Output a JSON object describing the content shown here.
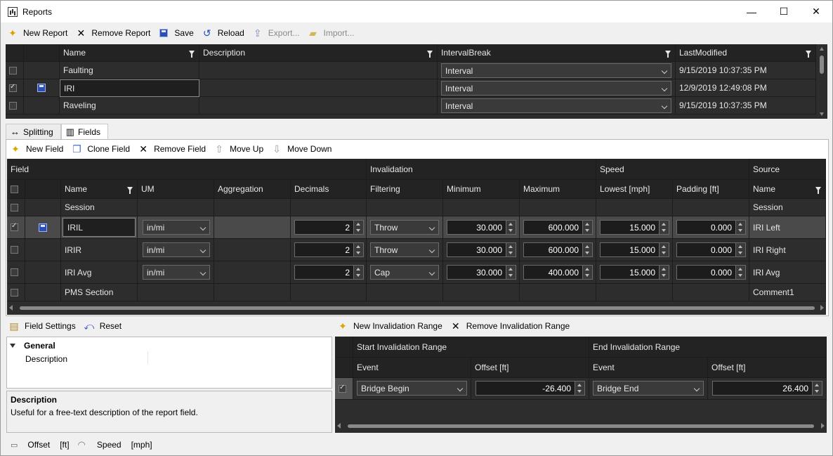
{
  "window": {
    "title": "Reports",
    "minimize": "—",
    "maximize": "☐",
    "close": "✕"
  },
  "reports_toolbar": {
    "new_report": "New Report",
    "remove_report": "Remove Report",
    "save": "Save",
    "reload": "Reload",
    "export": "Export...",
    "import": "Import..."
  },
  "reports_grid": {
    "columns": [
      "Name",
      "Description",
      "IntervalBreak",
      "LastModified"
    ],
    "rows": [
      {
        "checked": false,
        "saved": false,
        "name": "Faulting",
        "description": "",
        "interval_break": "Interval",
        "last_modified": "9/15/2019 10:37:35 PM"
      },
      {
        "checked": true,
        "saved": true,
        "name": "IRI",
        "description": "",
        "interval_break": "Interval",
        "last_modified": "12/9/2019 12:49:08 PM"
      },
      {
        "checked": false,
        "saved": false,
        "name": "Raveling",
        "description": "",
        "interval_break": "Interval",
        "last_modified": "9/15/2019 10:37:35 PM"
      }
    ]
  },
  "tabs": [
    {
      "label": "Splitting"
    },
    {
      "label": "Fields",
      "active": true
    }
  ],
  "fields_toolbar": {
    "new_field": "New Field",
    "clone_field": "Clone Field",
    "remove_field": "Remove Field",
    "move_up": "Move Up",
    "move_down": "Move Down"
  },
  "fields_grid": {
    "groups": {
      "field": "Field",
      "invalidation": "Invalidation",
      "speed": "Speed",
      "source": "Source"
    },
    "columns": {
      "name": "Name",
      "um": "UM",
      "aggregation": "Aggregation",
      "decimals": "Decimals",
      "filtering": "Filtering",
      "minimum": "Minimum",
      "maximum": "Maximum",
      "lowest": "Lowest  [mph]",
      "padding": "Padding  [ft]",
      "source_name": "Name"
    },
    "rows": [
      {
        "checked": false,
        "saved": false,
        "name": "Session",
        "source": "Session",
        "editors": false
      },
      {
        "checked": true,
        "saved": true,
        "selected": true,
        "name": "IRIL",
        "um": "in/mi",
        "decimals": "2",
        "filtering": "Throw",
        "minimum": "30.000",
        "maximum": "600.000",
        "lowest": "15.000",
        "padding": "0.000",
        "source": "IRI Left",
        "editors": true
      },
      {
        "checked": false,
        "saved": false,
        "name": "IRIR",
        "um": "in/mi",
        "decimals": "2",
        "filtering": "Throw",
        "minimum": "30.000",
        "maximum": "600.000",
        "lowest": "15.000",
        "padding": "0.000",
        "source": "IRI Right",
        "editors": true
      },
      {
        "checked": false,
        "saved": false,
        "name": "IRI Avg",
        "um": "in/mi",
        "decimals": "2",
        "filtering": "Cap",
        "minimum": "30.000",
        "maximum": "400.000",
        "lowest": "15.000",
        "padding": "0.000",
        "source": "IRI Avg",
        "editors": true
      },
      {
        "checked": false,
        "saved": false,
        "name": "PMS Section",
        "source": "Comment1",
        "editors": false
      }
    ]
  },
  "field_settings": {
    "toolbar": {
      "field_settings": "Field Settings",
      "reset": "Reset"
    },
    "category": "General",
    "property": "Description",
    "property_value": "",
    "help_title": "Description",
    "help_text": "Useful for a free-text description of the report field."
  },
  "invalidation": {
    "toolbar": {
      "new_range": "New Invalidation Range",
      "remove_range": "Remove Invalidation Range"
    },
    "groups": {
      "start": "Start Invalidation Range",
      "end": "End Invalidation Range"
    },
    "columns": {
      "start_event": "Event",
      "start_offset": "Offset  [ft]",
      "end_event": "Event",
      "end_offset": "Offset  [ft]"
    },
    "rows": [
      {
        "checked": true,
        "start_event": "Bridge Begin",
        "start_offset": "-26.400",
        "end_event": "Bridge End",
        "end_offset": "26.400"
      }
    ]
  },
  "status_bar": {
    "offset_label": "Offset",
    "offset_unit": "[ft]",
    "speed_label": "Speed",
    "speed_unit": "[mph]"
  },
  "colors": {
    "grid_bg": "#2d2d2d",
    "header_bg": "#232323",
    "accent_blue": "#2d4fb5"
  }
}
